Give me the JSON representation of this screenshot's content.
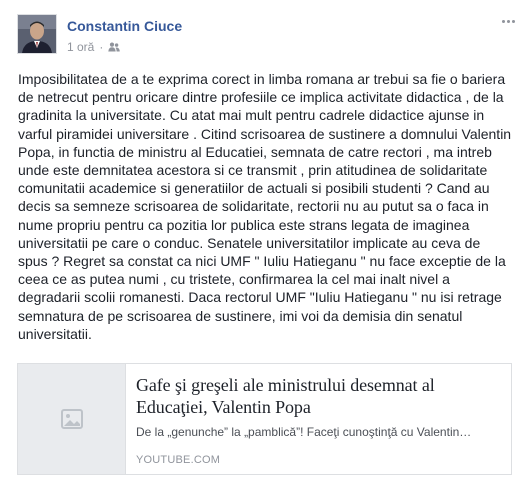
{
  "post": {
    "author": "Constantin Ciuce",
    "time": "1 oră",
    "separator": "·",
    "privacy_icon": "friends-icon",
    "more_icon": "more-options-icon",
    "body": "Imposibilitatea de a te exprima corect in limba romana ar trebui sa fie o bariera de netrecut pentru oricare dintre profesiile ce implica activitate didactica , de la gradinita la universitate. Cu atat mai mult pentru cadrele didactice ajunse in varful piramidei universitare . Citind scrisoarea de sustinere a domnului Valentin Popa, in functia de ministru al Educatiei, semnata de catre rectori , ma intreb unde este demnitatea acestora si ce transmit , prin atitudinea de solidaritate comunitatii academice si generatiilor de actuali si posibili studenti ? Cand au decis sa semneze scrisoarea de solidaritate, rectorii nu au putut sa o faca in nume propriu pentru ca pozitia lor publica este strans legata de imaginea universitatii pe care o conduc. Senatele universitatilor implicate au ceva de spus ? Regret sa constat ca nici UMF \" Iuliu Hatieganu \" nu face exceptie de la ceea ce as putea numi , cu tristete, confirmarea la cel mai inalt nivel a degradarii scolii romanesti. Daca rectorul UMF \"Iuliu Hatieganu \" nu isi retrage semnatura de pe scrisoarea de sustinere, imi voi da demisia din senatul universitatii."
  },
  "link": {
    "title": "Gafe şi greşeli ale ministrului desemnat al Educaţiei, Valentin Popa",
    "description": "De la „genunche” la „pamblică”! Faceţi cunoştinţă cu Valentin…",
    "domain": "YOUTUBE.COM",
    "thumbnail_icon": "image-placeholder-icon"
  },
  "colors": {
    "author": "#365899",
    "meta": "#90949c",
    "text": "#1d2129",
    "thumb_bg": "#e9ebee",
    "border": "#dddfe2"
  }
}
